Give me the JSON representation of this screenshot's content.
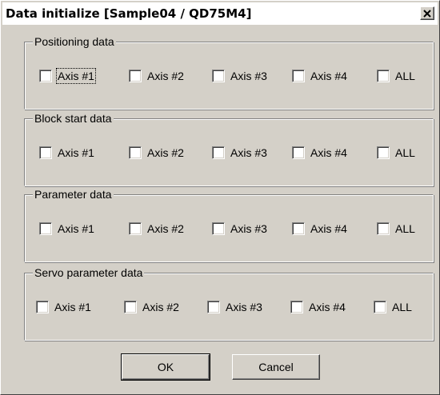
{
  "window": {
    "title": "Data initialize [Sample04 / QD75M4]",
    "close_glyph": "✕"
  },
  "groups": [
    {
      "title": "Positioning data",
      "checkboxes": [
        {
          "label": "Axis #1",
          "checked": false,
          "focused": true
        },
        {
          "label": "Axis #2",
          "checked": false
        },
        {
          "label": "Axis #3",
          "checked": false
        },
        {
          "label": "Axis #4",
          "checked": false
        },
        {
          "label": "ALL",
          "checked": false
        }
      ]
    },
    {
      "title": "Block start data",
      "checkboxes": [
        {
          "label": "Axis #1",
          "checked": false
        },
        {
          "label": "Axis #2",
          "checked": false
        },
        {
          "label": "Axis #3",
          "checked": false
        },
        {
          "label": "Axis #4",
          "checked": false
        },
        {
          "label": "ALL",
          "checked": false
        }
      ]
    },
    {
      "title": "Parameter data",
      "checkboxes": [
        {
          "label": "Axis #1",
          "checked": false
        },
        {
          "label": "Axis #2",
          "checked": false
        },
        {
          "label": "Axis #3",
          "checked": false
        },
        {
          "label": "Axis #4",
          "checked": false
        },
        {
          "label": "ALL",
          "checked": false
        }
      ]
    },
    {
      "title": "Servo parameter data",
      "checkboxes": [
        {
          "label": "Axis #1",
          "checked": false
        },
        {
          "label": "Axis #2",
          "checked": false
        },
        {
          "label": "Axis #3",
          "checked": false
        },
        {
          "label": "Axis #4",
          "checked": false
        },
        {
          "label": "ALL",
          "checked": false
        }
      ]
    }
  ],
  "buttons": {
    "ok": "OK",
    "cancel": "Cancel"
  },
  "colors": {
    "dialog_face": "#d4d0c8",
    "title_bg": "#ffffff"
  }
}
